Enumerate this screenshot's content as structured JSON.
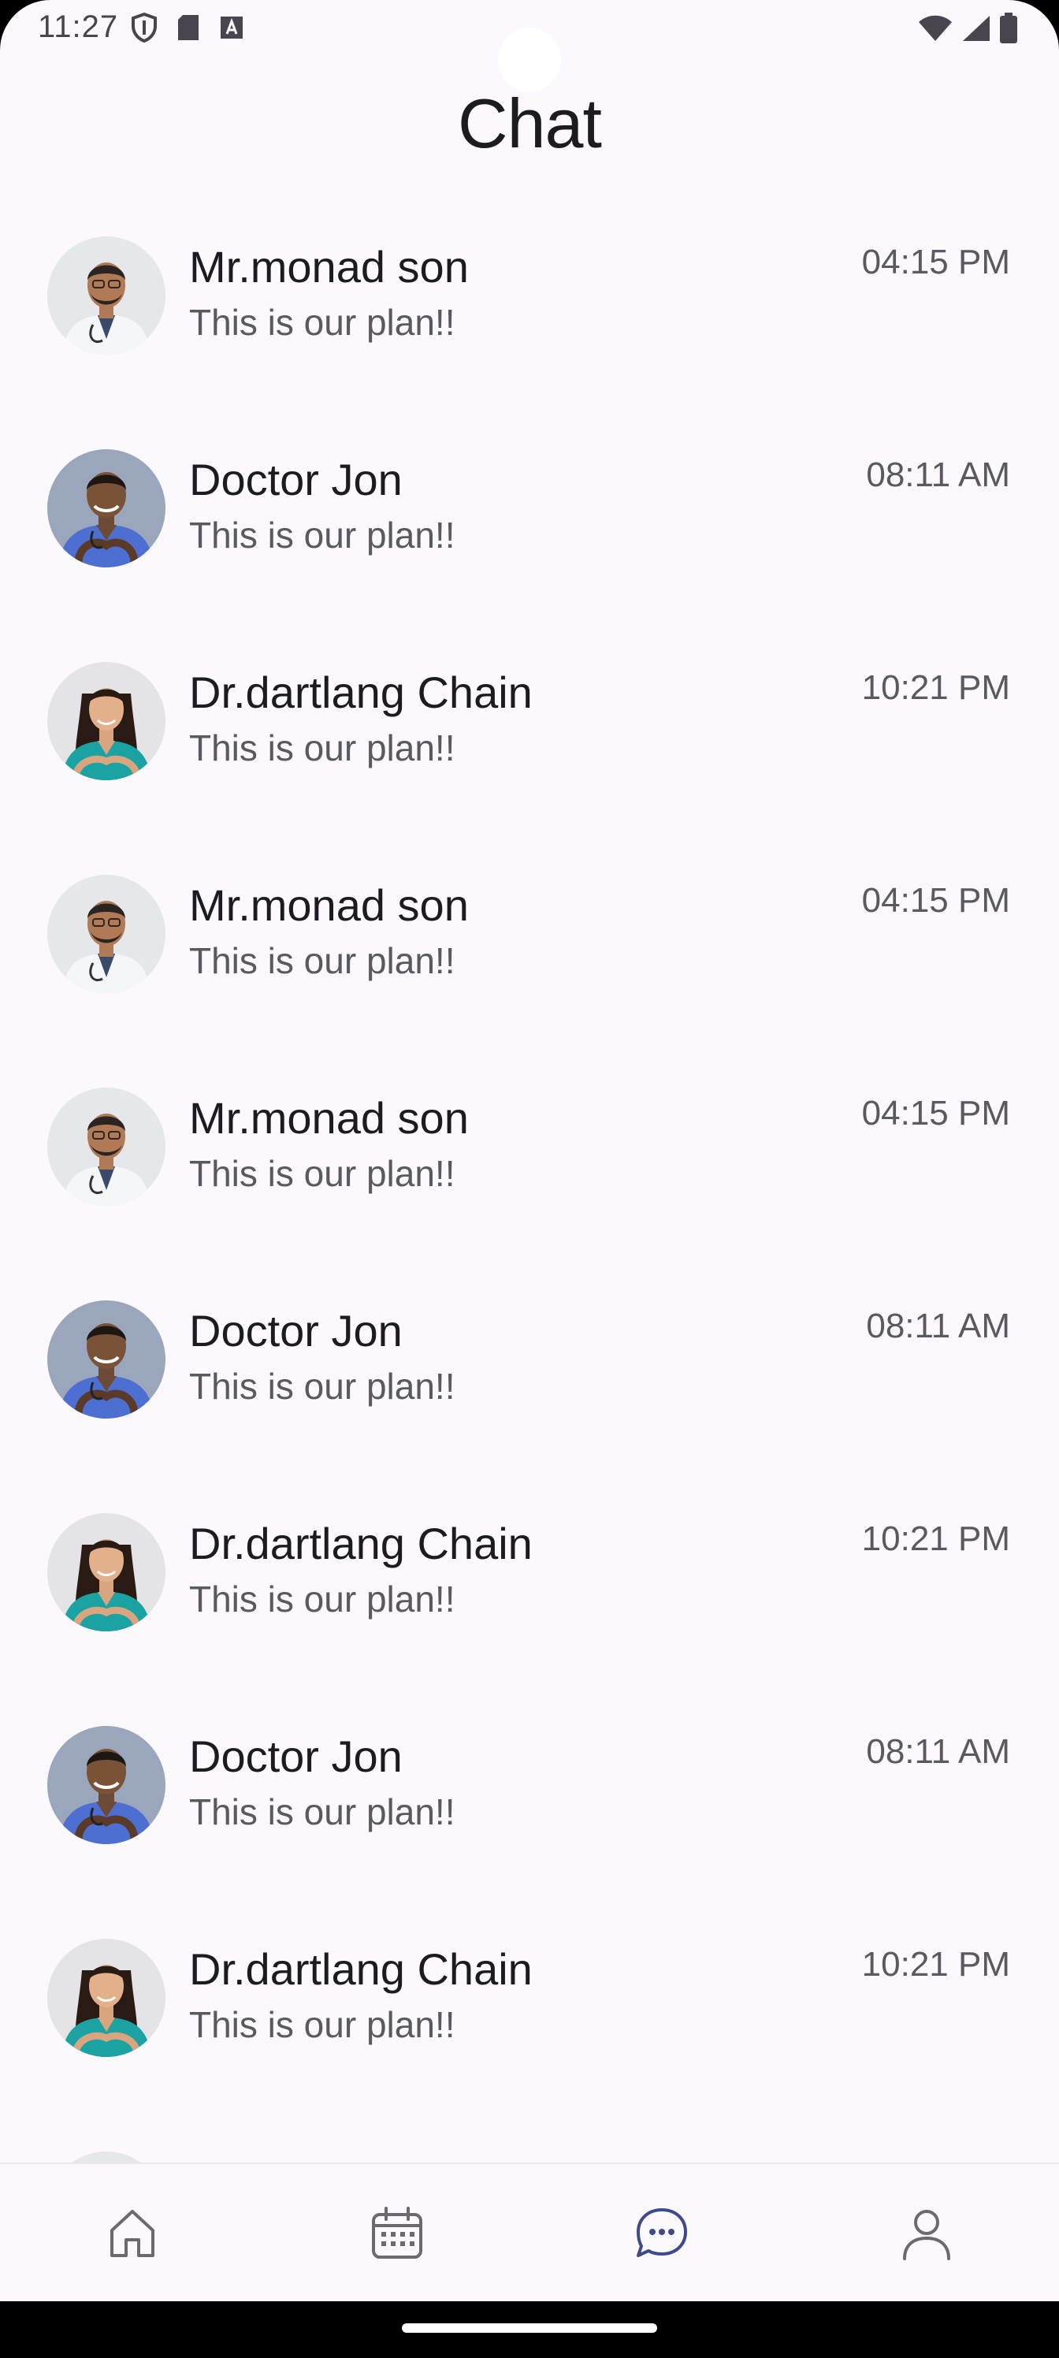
{
  "status_bar": {
    "time": "11:27"
  },
  "header": {
    "title": "Chat"
  },
  "chats": [
    {
      "name": "Mr.monad son",
      "message": "This is our plan!!",
      "time": "04:15 PM",
      "avatar": "male-doctor-white-coat"
    },
    {
      "name": "Doctor Jon",
      "message": "This is our plan!!",
      "time": "08:11 AM",
      "avatar": "male-doctor-blue-scrubs"
    },
    {
      "name": "Dr.dartlang Chain",
      "message": "This is our plan!!",
      "time": "10:21 PM",
      "avatar": "female-doctor-teal-scrubs"
    },
    {
      "name": "Mr.monad son",
      "message": "This is our plan!!",
      "time": "04:15 PM",
      "avatar": "male-doctor-white-coat"
    },
    {
      "name": "Mr.monad son",
      "message": "This is our plan!!",
      "time": "04:15 PM",
      "avatar": "male-doctor-white-coat"
    },
    {
      "name": "Doctor Jon",
      "message": "This is our plan!!",
      "time": "08:11 AM",
      "avatar": "male-doctor-blue-scrubs"
    },
    {
      "name": "Dr.dartlang Chain",
      "message": "This is our plan!!",
      "time": "10:21 PM",
      "avatar": "female-doctor-teal-scrubs"
    },
    {
      "name": "Doctor Jon",
      "message": "This is our plan!!",
      "time": "08:11 AM",
      "avatar": "male-doctor-blue-scrubs"
    },
    {
      "name": "Dr.dartlang Chain",
      "message": "This is our plan!!",
      "time": "10:21 PM",
      "avatar": "female-doctor-teal-scrubs"
    },
    {
      "name": "",
      "message": "",
      "time": "",
      "avatar": "male-doctor-white-coat"
    }
  ],
  "bottom_nav": {
    "items": [
      {
        "icon": "home-icon",
        "active": false
      },
      {
        "icon": "calendar-icon",
        "active": false
      },
      {
        "icon": "chat-bubble-icon",
        "active": true
      },
      {
        "icon": "profile-icon",
        "active": false
      }
    ],
    "active_color": "#3f4a8a",
    "inactive_color": "#6b6a70"
  },
  "colors": {
    "background": "#fbf8fe",
    "text_primary": "#1c1b1f",
    "text_secondary": "#5a5860"
  }
}
